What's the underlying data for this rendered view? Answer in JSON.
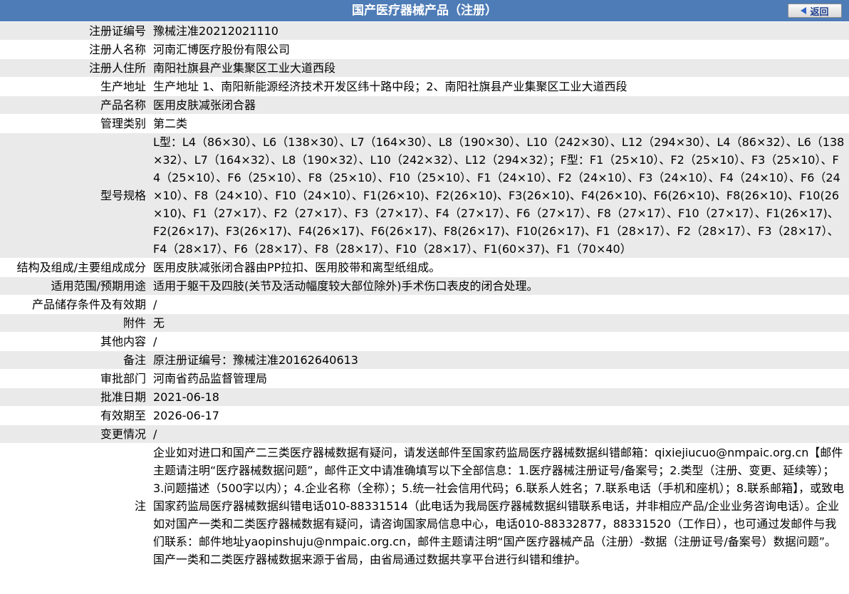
{
  "header": {
    "title": "国产医疗器械产品（注册）",
    "back_label": "返回"
  },
  "rows": [
    {
      "label": "注册证编号",
      "value": "豫械注准20212021110"
    },
    {
      "label": "注册人名称",
      "value": "河南汇博医疗股份有限公司"
    },
    {
      "label": "注册人住所",
      "value": "南阳社旗县产业集聚区工业大道西段"
    },
    {
      "label": "生产地址",
      "value": "生产地址 1、南阳新能源经济技术开发区纬十路中段；2、南阳社旗县产业集聚区工业大道西段"
    },
    {
      "label": "产品名称",
      "value": "医用皮肤减张闭合器"
    },
    {
      "label": "管理类别",
      "value": "第二类"
    },
    {
      "label": "型号规格",
      "value": "L型：L4（86×30）、L6（138×30）、L7（164×30）、L8（190×30）、L10（242×30）、L12（294×30）、L4（86×32）、L6（138×32）、L7（164×32）、L8（190×32）、L10（242×32）、L12（294×32）；F型：F1（25×10）、F2（25×10）、F3（25×10）、F4（25×10）、F6（25×10）、F8（25×10）、F10（25×10）、F1（24×10）、F2（24×10）、F3（24×10）、F4（24×10）、F6（24×10）、F8（24×10）、F10（24×10）、F1(26×10)、F2(26×10)、F3(26×10)、F4(26×10)、F6(26×10)、F8(26×10)、F10(26×10)、F1（27×17）、F2（27×17）、F3（27×17）、F4（27×17）、F6（27×17）、F8（27×17）、F10（27×17）、F1(26×17)、F2(26×17)、F3(26×17)、F4(26×17)、F6(26×17)、F8(26×17)、F10(26×17)、F1（28×17）、F2（28×17）、F3（28×17）、F4（28×17）、F6（28×17）、F8（28×17）、F10（28×17）、F1(60×37)、F1（70×40）"
    },
    {
      "label": "结构及组成/主要组成成分",
      "value": "医用皮肤减张闭合器由PP拉扣、医用胶带和离型纸组成。"
    },
    {
      "label": "适用范围/预期用途",
      "value": "适用于躯干及四肢(关节及活动幅度较大部位除外)手术伤口表皮的闭合处理。"
    },
    {
      "label": "产品储存条件及有效期",
      "value": "/"
    },
    {
      "label": "附件",
      "value": "无"
    },
    {
      "label": "其他内容",
      "value": "/"
    },
    {
      "label": "备注",
      "value": "原注册证编号：豫械注准20162640613"
    },
    {
      "label": "审批部门",
      "value": "河南省药品监督管理局"
    },
    {
      "label": "批准日期",
      "value": "2021-06-18"
    },
    {
      "label": "有效期至",
      "value": "2026-06-17"
    },
    {
      "label": "变更情况",
      "value": "/"
    },
    {
      "label": "注",
      "value": "企业如对进口和国产二三类医疗器械数据有疑问，请发送邮件至国家药监局医疗器械数据纠错邮箱：qixiejiucuo@nmpaic.org.cn【邮件主题请注明“医疗器械数据问题”，邮件正文中请准确填写以下全部信息：1.医疗器械注册证号/备案号；2.类型（注册、变更、延续等）；3.问题描述（500字以内）；4.企业名称（全称）；5.统一社会信用代码；6.联系人姓名；7.联系电话（手机和座机）；8.联系邮箱】，或致电国家药监局医疗器械数据纠错电话010-88331514（此电话为我局医疗器械数据纠错联系电话，并非相应产品/企业业务咨询电话）。企业如对国产一类和二类医疗器械数据有疑问，请咨询国家局信息中心，电话010-88332877，88331520（工作日），也可通过发邮件与我们联系：邮件地址yaopinshuju@nmpaic.org.cn，邮件主题请注明“国产医疗器械产品（注册）-数据（注册证号/备案号）数据问题”。国产一类和二类医疗器械数据来源于省局，由省局通过数据共享平台进行纠错和维护。"
    }
  ]
}
